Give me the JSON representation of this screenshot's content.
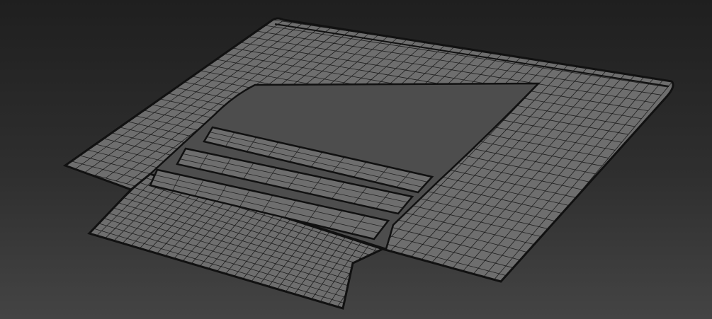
{
  "viewport": {
    "background_top": "#1f1f1f",
    "background_bottom": "#444444",
    "shading": "wireframe-on-shaded"
  },
  "model": {
    "object": "car-hood-mesh",
    "surface_color": "#6e6e6e",
    "surface_shadow_color": "#4d4d4d",
    "wire_color": "#111111",
    "louver_count": 3
  }
}
